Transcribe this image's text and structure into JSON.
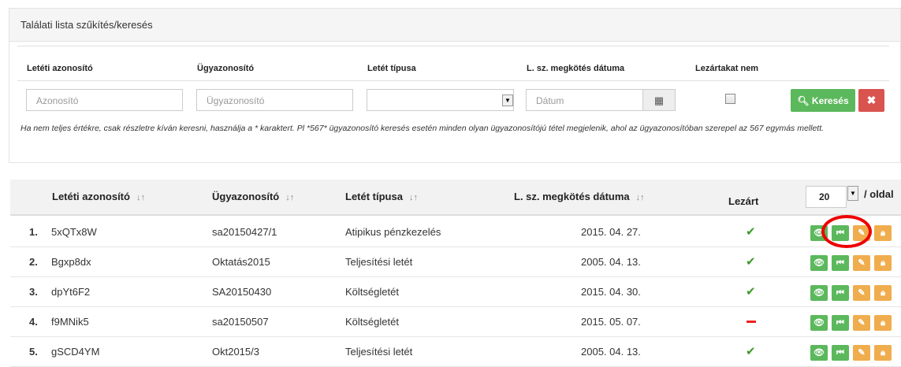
{
  "filter": {
    "title": "Találati lista szűkítés/keresés",
    "labels": {
      "deposit_id": "Letéti azonosító",
      "case_id": "Ügyazonosító",
      "deposit_type": "Letét típusa",
      "contract_date": "L. sz. megkötés dátuma",
      "closed_not": "Lezártakat nem"
    },
    "placeholders": {
      "deposit_id": "Azonosító",
      "case_id": "Ügyazonosító",
      "contract_date": "Dátum"
    },
    "search_label": "Keresés",
    "hint_text": "Ha nem teljes értékre, csak részletre kíván keresni, használja a * karaktert. Pl *567* ügyazonosító keresés esetén minden olyan ügyazonosítójú tétel megjelenik, ahol az ügyazonosítóban szerepel az 567 egymás mellett."
  },
  "table": {
    "headers": {
      "deposit_id": "Letéti azonosító",
      "case_id": "Ügyazonosító",
      "deposit_type": "Letét típusa",
      "contract_date": "L. sz. megkötés dátuma",
      "closed": "Lezárt"
    },
    "per_page_value": "20",
    "per_page_label": "/ oldal",
    "rows": [
      {
        "num": "1.",
        "deposit_id": "5xQTx8W",
        "case_id": "sa20150427/1",
        "type": "Atipikus pénzkezelés",
        "date": "2015. 04. 27.",
        "closed": true
      },
      {
        "num": "2.",
        "deposit_id": "Bgxp8dx",
        "case_id": "Oktatás2015",
        "type": "Teljesítési letét",
        "date": "2005. 04. 13.",
        "closed": true
      },
      {
        "num": "3.",
        "deposit_id": "dpYt6F2",
        "case_id": "SA20150430",
        "type": "Költségletét",
        "date": "2015. 04. 30.",
        "closed": true
      },
      {
        "num": "4.",
        "deposit_id": "f9MNik5",
        "case_id": "sa20150507",
        "type": "Költségletét",
        "date": "2015. 05. 07.",
        "closed": false
      },
      {
        "num": "5.",
        "deposit_id": "gSCD4YM",
        "case_id": "Okt2015/3",
        "type": "Teljesítési letét",
        "date": "2005. 04. 13.",
        "closed": true
      }
    ]
  },
  "colors": {
    "green": "#5cb85c",
    "orange": "#f0ad4e",
    "red": "#d9534f",
    "highlight": "#ee0000"
  }
}
